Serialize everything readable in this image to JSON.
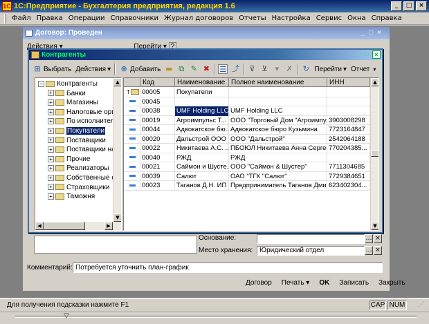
{
  "app": {
    "title": "1С:Предприятие - Бухгалтерия предприятия, редакция 1.6",
    "icon_text": "1С"
  },
  "menu": [
    "Файл",
    "Правка",
    "Операции",
    "Справочники",
    "Журнал договоров",
    "Отчеты",
    "Настройка",
    "Сервис",
    "Окна",
    "Справка"
  ],
  "dogovor_window": {
    "title": "Договор: Проведен",
    "toolbar": {
      "actions": "Действия",
      "goto": "Перейти",
      "help": "?"
    },
    "fields": {
      "osnovanie_label": "Основание:",
      "mesto_label": "Место хранения:",
      "mesto_value": "Юридический отдел",
      "comment_label": "Комментарий:",
      "comment_value": "Потребуется уточнить план-график"
    },
    "bottom_buttons": [
      "Договор",
      "Печать",
      "OK",
      "Записать",
      "Закрыть"
    ]
  },
  "kontragenty_window": {
    "title": "Контрагенты",
    "toolbar": {
      "select": "Выбрать",
      "actions": "Действия",
      "add": "Добавить",
      "goto": "Перейти",
      "report": "Отчет"
    },
    "tree": [
      {
        "label": "Контрагенты",
        "level": 0,
        "pm": "−"
      },
      {
        "label": "Банки",
        "level": 1,
        "pm": "+"
      },
      {
        "label": "Магазины",
        "level": 1,
        "pm": "+"
      },
      {
        "label": "Налоговые орга",
        "level": 1,
        "pm": "+"
      },
      {
        "label": "По исполнитель",
        "level": 1,
        "pm": "+"
      },
      {
        "label": "Покупатели",
        "level": 1,
        "pm": "+",
        "selected": true
      },
      {
        "label": "Поставщики",
        "level": 1,
        "pm": "+"
      },
      {
        "label": "Поставщики на",
        "level": 1,
        "pm": "+"
      },
      {
        "label": "Прочие",
        "level": 1,
        "pm": "+"
      },
      {
        "label": "Реализаторы",
        "level": 1,
        "pm": "+"
      },
      {
        "label": "Собственные ор",
        "level": 1,
        "pm": "+"
      },
      {
        "label": "Страховщики",
        "level": 1,
        "pm": "+"
      },
      {
        "label": "Таможня",
        "level": 1,
        "pm": "+"
      }
    ],
    "columns": [
      "Код",
      "Наименование",
      "Полное наименование",
      "ИНН"
    ],
    "rows": [
      {
        "icon": "folder",
        "code": "00005",
        "name": "Покупатели",
        "full": "",
        "inn": ""
      },
      {
        "icon": "item",
        "code": "00045",
        "name": "",
        "full": "",
        "inn": ""
      },
      {
        "icon": "item",
        "code": "00038",
        "name": "UMF Holding LLC",
        "full": "UMF Holding LLC",
        "inn": "",
        "highlight": true
      },
      {
        "icon": "item",
        "code": "00019",
        "name": "Агроимпульс Т...",
        "full": "ООО \"Торговый Дом \"Агроимпу...",
        "inn": "3903008298"
      },
      {
        "icon": "item",
        "code": "00044",
        "name": "Адвокатское бю...",
        "full": "Адвокатское бюро Кузьмина",
        "inn": "7723164847"
      },
      {
        "icon": "item",
        "code": "00020",
        "name": "Дальстрой ООО",
        "full": "ООО \"Дальстрой\"",
        "inn": "2542064188"
      },
      {
        "icon": "item",
        "code": "00022",
        "name": "Никитаева А.С. ...",
        "full": "ПБОЮЛ Никитаева Анна Сергее...",
        "inn": "770204385..."
      },
      {
        "icon": "item",
        "code": "00040",
        "name": "РЖД",
        "full": "РЖД",
        "inn": ""
      },
      {
        "icon": "item",
        "code": "00021",
        "name": "Саймон и Шусте...",
        "full": "ООО \"Саймон & Шустер\"",
        "inn": "7711304685"
      },
      {
        "icon": "item",
        "code": "00039",
        "name": "Салют",
        "full": "ОАО \"ТГК \"Салют\"",
        "inn": "7729384651"
      },
      {
        "icon": "item",
        "code": "00023",
        "name": "Таганов Д.Н. ИП",
        "full": "Предприниматель Таганов Дми...",
        "inn": "623402304..."
      }
    ]
  },
  "status": {
    "hint": "Для получения подсказки нажмите F1",
    "cap": "CAP",
    "num": "NUM"
  },
  "colors": {
    "title_active": "#0a246a",
    "selection": "#0a246a",
    "window_bg": "#d4d0c8"
  }
}
